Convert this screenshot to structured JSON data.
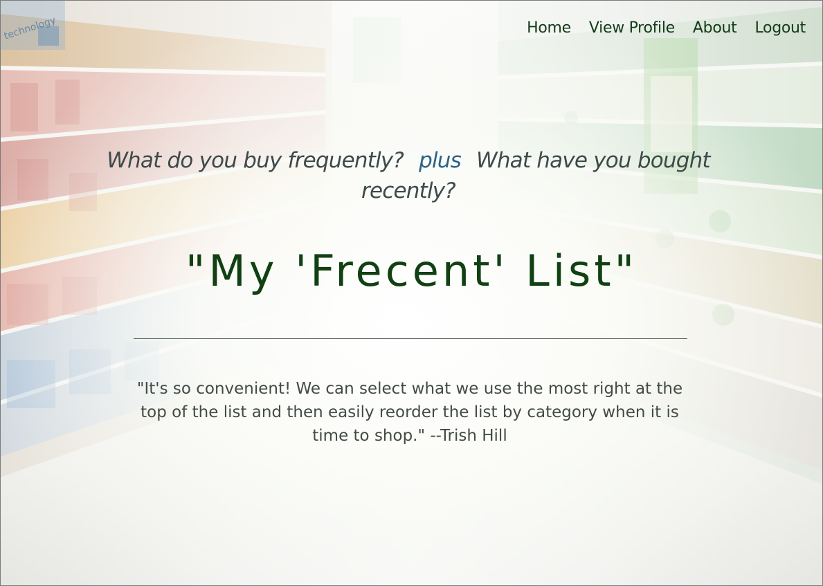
{
  "nav": {
    "home": "Home",
    "view_profile": "View Profile",
    "about": "About",
    "logout": "Logout"
  },
  "badge": {
    "text": "technology"
  },
  "hero": {
    "question_1": "What do you buy frequently?",
    "plus": "plus",
    "question_2": "What have you bought recently?",
    "title": "\"My 'Frecent' List\"",
    "testimonial": "\"It's so convenient! We can select what we use the most right at the top of the list and then easily reorder the list by category when it is time to shop.\" --Trish Hill"
  },
  "colors": {
    "nav_text": "#133a19",
    "title": "#114012",
    "plus_accent": "#2d6287",
    "body_text": "#434b46"
  }
}
